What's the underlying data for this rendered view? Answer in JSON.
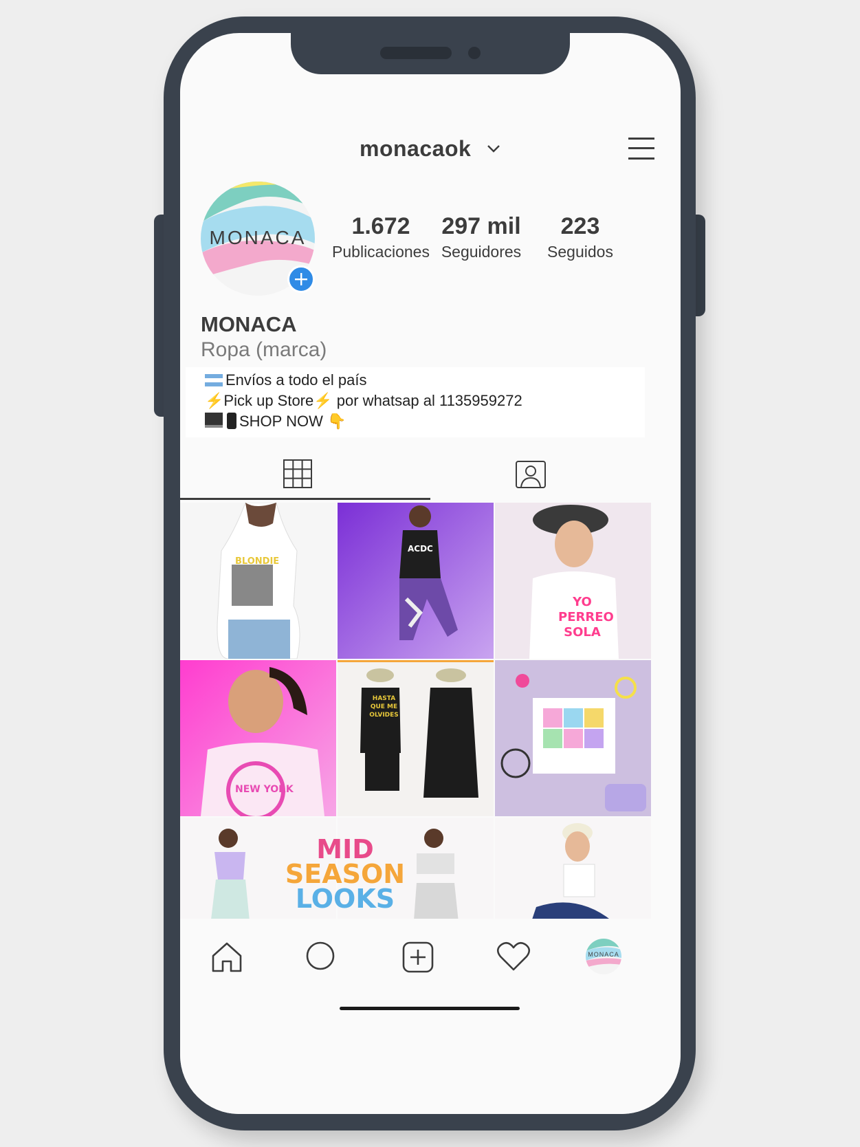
{
  "profile": {
    "username": "monacaok",
    "avatar_text": "MONACA",
    "stats": [
      {
        "value": "1.672",
        "label": "Publicaciones"
      },
      {
        "value": "297 mil",
        "label": "Seguidores"
      },
      {
        "value": "223",
        "label": "Seguidos"
      }
    ],
    "name": "MONACA",
    "category": "Ropa (marca)",
    "bio": {
      "line1": "Envíos a todo el país",
      "line2a": "Pick up Store",
      "line2b": " por whatsap al 1135959272",
      "line3": "SHOP NOW"
    }
  },
  "tabs": [
    {
      "name": "grid-tab",
      "icon": "grid-icon",
      "active": true
    },
    {
      "name": "tagged-tab",
      "icon": "tagged-person-icon",
      "active": false
    }
  ],
  "feed": {
    "tiles": [
      {
        "name": "post-white-tee-blondie",
        "text": "BLONDIE"
      },
      {
        "name": "post-purple-tiedye-acdc",
        "text": "ACDC"
      },
      {
        "name": "post-yo-perreo-sola",
        "text": "YO PERREO SOLA"
      },
      {
        "name": "post-pink-new-york",
        "text": "NEW YORK"
      },
      {
        "name": "post-hasta-que-me-olvides",
        "text": "HASTA QUE ME OLVIDES"
      },
      {
        "name": "post-flatlay-lips-tee",
        "text": ""
      },
      {
        "name": "post-mid-season-girl-left",
        "text": ""
      },
      {
        "name": "post-mid-season-looks",
        "text_line1": "MID",
        "text_line2": "SEASON",
        "text_line3": "LOOKS"
      },
      {
        "name": "post-mid-season-girl-right",
        "text": ""
      },
      {
        "name": "post-bucket-hat-jeans",
        "text": ""
      }
    ]
  },
  "bottom_nav": {
    "items": [
      "home-icon",
      "search-icon",
      "new-post-icon",
      "activity-heart-icon",
      "profile-avatar"
    ],
    "avatar_text": "MONACA"
  },
  "colors": {
    "phone_frame": "#3a424d",
    "accent_blue": "#2f8be6",
    "text_dark": "#3c3c3c"
  }
}
